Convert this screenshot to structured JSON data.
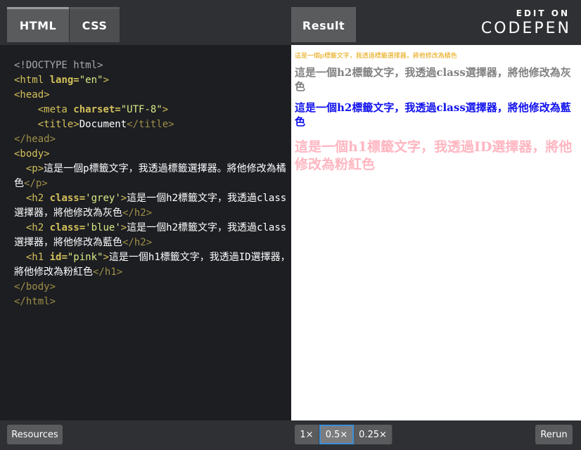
{
  "tabs": {
    "html": "HTML",
    "css": "CSS",
    "result": "Result"
  },
  "logo": {
    "edit_on": "EDIT ON",
    "codepen": "CODEPEN"
  },
  "code": {
    "doctype": "<!DOCTYPE html>",
    "html_open_tag": "<html",
    "html_lang_attr": " lang=",
    "html_lang_val": "\"en\"",
    "html_open_end": ">",
    "head_open": "<head>",
    "meta_open": "<meta",
    "meta_attr": " charset=",
    "meta_val": "\"UTF-8\"",
    "meta_end": ">",
    "title_open": "<title>",
    "title_text": "Document",
    "title_close": "</title>",
    "head_close": "</head>",
    "body_open": "<body>",
    "p_open": "<p>",
    "p_text": "這是一個p標籤文字，我透過標籤選擇器。將他修改為橘色",
    "p_close": "</p>",
    "h2_open": "<h2",
    "class_attr": " class=",
    "grey_val": "'grey'",
    "blue_val": "'blue'",
    "tag_end": ">",
    "h2_grey_text": "這是一個h2標籤文字，我透過class選擇器，將他修改為灰色",
    "h2_blue_text": "這是一個h2標籤文字，我透過class選擇器，將他修改為藍色",
    "h2_close": "</h2>",
    "h1_open": "<h1",
    "id_attr": " id=",
    "pink_val": "\"pink\"",
    "h1_text": "這是一個h1標籤文字，我透過ID選擇器，將他修改為粉紅色",
    "h1_close": "</h1>",
    "body_close": "</body>",
    "html_close": "</html>"
  },
  "result": {
    "p": "這是一個p標籤文字，我透過標籤選擇器，將他修改為橘色",
    "h2_grey": "這是一個h2標籤文字，我透過class選擇器，將他修改為灰色",
    "h2_blue": "這是一個h2標籤文字，我透過class選擇器，將他修改為藍色",
    "h1_pink": "這是一個h1標籤文字，我透過ID選擇器，將他修改為粉紅色"
  },
  "bottom": {
    "resources": "Resources",
    "zoom_1": "1×",
    "zoom_05": "0.5×",
    "zoom_025": "0.25×",
    "rerun": "Rerun"
  },
  "colors": {
    "orange": "#e6a100",
    "grey": "#808080",
    "blue": "#1010ee",
    "pink": "#ffb6c1"
  }
}
